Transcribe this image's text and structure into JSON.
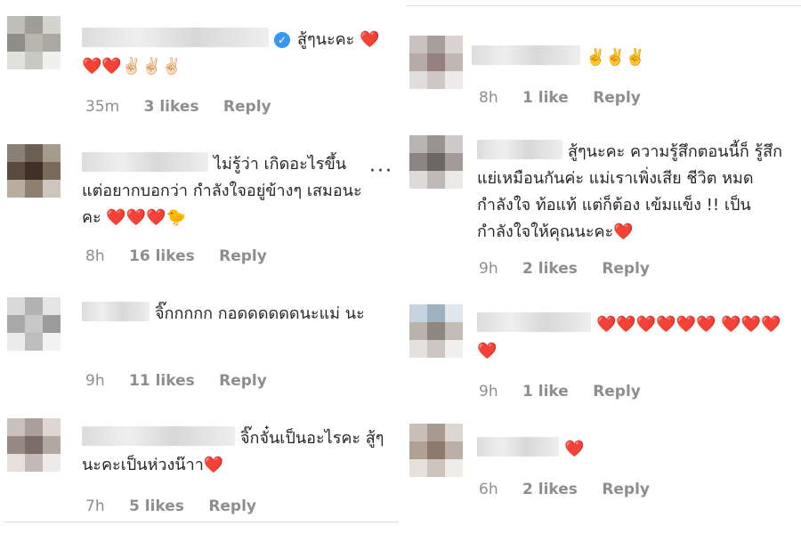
{
  "left": [
    {
      "text": "สู้ๆนะคะ ❤️❤️❤️✌🏻✌🏻✌🏻",
      "verified": true,
      "time": "35m",
      "likes": "3 likes",
      "reply": "Reply"
    },
    {
      "text": "ไม่รู้ว่า เกิดอะไรขึ้น แต่อยากบอกว่า กำลังใจอยู่ข้างๆ เสมอนะคะ ❤️❤️❤️🐤",
      "time": "8h",
      "likes": "16 likes",
      "reply": "Reply",
      "more": "···"
    },
    {
      "text": "จิ๊กกกกก กอดดดดดดนะแม่ นะ",
      "time": "9h",
      "likes": "11 likes",
      "reply": "Reply"
    },
    {
      "text": "จิ๊กจั๋นเป็นอะไรคะ สู้ๆนะคะเป็นห่วงน๊าา❤️",
      "time": "7h",
      "likes": "5 likes",
      "reply": "Reply"
    }
  ],
  "right": [
    {
      "text": "✌️✌️✌️",
      "time": "8h",
      "likes": "1 like",
      "reply": "Reply"
    },
    {
      "text": "สู้ๆนะคะ ความรู้สึกตอนนี้ก็ รู้สึกแย่เหมือนกันค่ะ แม่เราเพิ่งเสีย ชีวิต หมดกำลังใจ ท้อแท้ แต่ก็ต้อง เข้มแข็ง !! เป็นกำลังใจให้คุณนะคะ❤️",
      "time": "9h",
      "likes": "2 likes",
      "reply": "Reply"
    },
    {
      "text": "❤️❤️❤️❤️❤️❤️ ❤️❤️❤️❤️",
      "time": "9h",
      "likes": "1 like",
      "reply": "Reply"
    },
    {
      "text": "❤️",
      "time": "6h",
      "likes": "2 likes",
      "reply": "Reply"
    }
  ],
  "colors": {
    "verified": "#3897f0",
    "meta_text": "#8e8e8e",
    "comment_text": "#262626",
    "heart": "#ed4956"
  }
}
